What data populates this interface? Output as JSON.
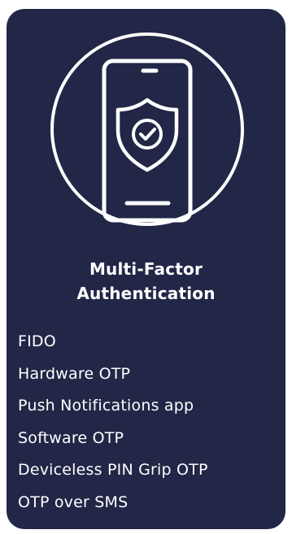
{
  "card": {
    "title_line1": "Multi-Factor",
    "title_line2": "Authentication",
    "icon": "phone-shield-check-icon",
    "colors": {
      "background": "#222747",
      "foreground": "#ffffff"
    }
  },
  "features": [
    "FIDO",
    "Hardware OTP",
    "Push Notifications app",
    "Software OTP",
    "Deviceless PIN Grip OTP",
    "OTP over SMS"
  ]
}
